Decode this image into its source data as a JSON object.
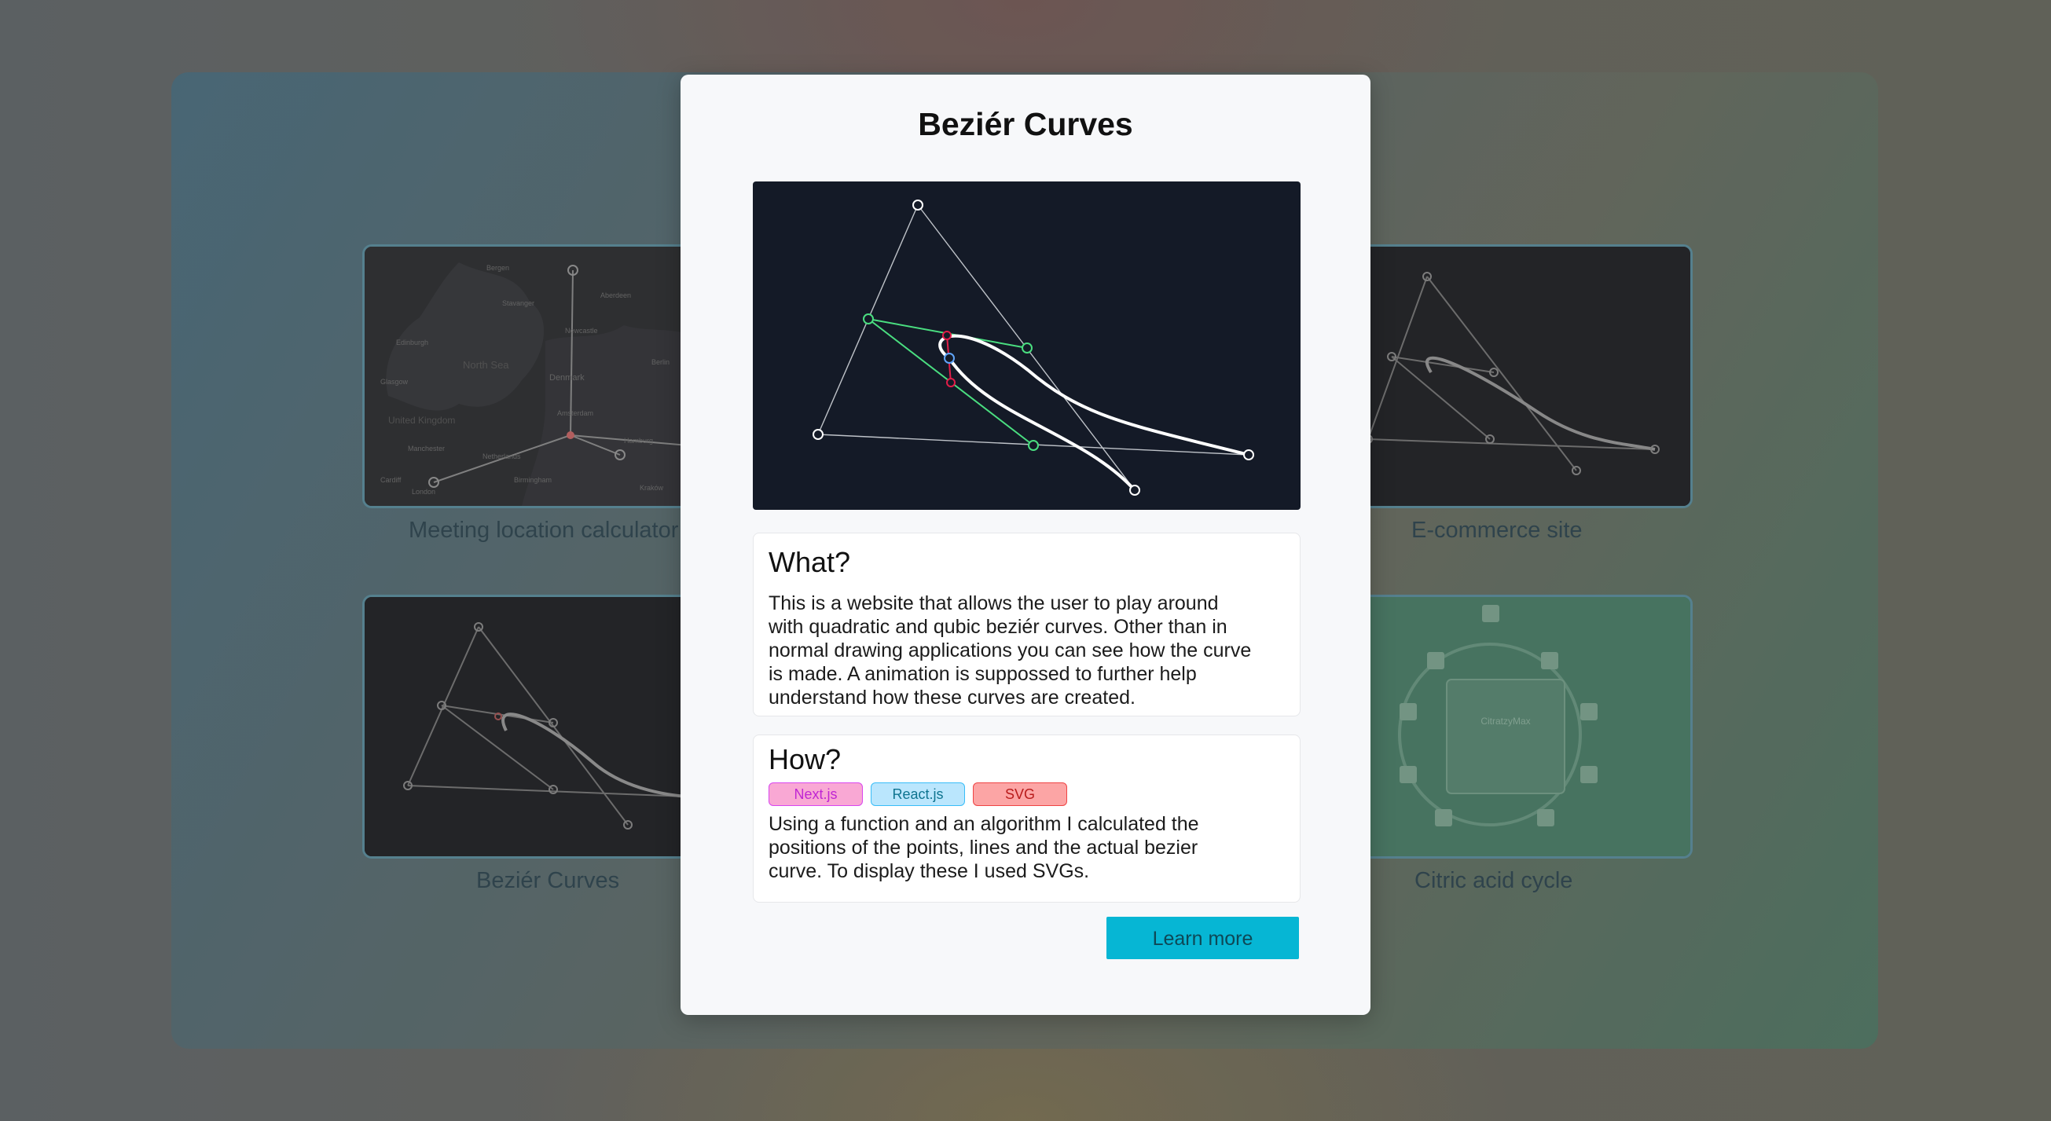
{
  "projects": [
    {
      "caption": "Meeting location calculator"
    },
    {
      "caption": "E-commerce site"
    },
    {
      "caption": "Beziér Curves"
    },
    {
      "caption": "Citric acid cycle"
    }
  ],
  "map_labels": [
    "Bergen",
    "Stavanger",
    "Aberdeen",
    "Edinburgh",
    "North Sea",
    "Denmark",
    "United Kingdom",
    "Glasgow",
    "Newcastle",
    "Manchester",
    "London",
    "Amsterdam",
    "Hamburg",
    "Berlin",
    "Cardiff",
    "Birmingham",
    "Netherlands",
    "Kraków"
  ],
  "citric_card": {
    "title": "CitratzyMax"
  },
  "modal": {
    "title": "Beziér Curves",
    "what": {
      "heading": "What?",
      "lines": [
        "This is a website that allows the user to play around",
        "with quadratic and qubic beziér curves. Other than in",
        "normal drawing applications you can see how the curve",
        "is made. A animation is suppossed to further help",
        "understand how these curves are created."
      ]
    },
    "how": {
      "heading": "How?",
      "tags": [
        {
          "label": "Next.js",
          "bg": "#f9a8d4",
          "border": "#d946ef",
          "color": "#c026d3"
        },
        {
          "label": "React.js",
          "bg": "#bae6fd",
          "border": "#38bdf8",
          "color": "#0e7490"
        },
        {
          "label": "SVG",
          "bg": "#fca5a5",
          "border": "#ef4444",
          "color": "#b91c1c"
        }
      ],
      "lines": [
        "Using a function and an algorithm I calculated the",
        "positions of the points, lines and the actual bezier",
        "curve. To display these I used SVGs."
      ]
    },
    "learn_more": "Learn more"
  },
  "colors": {
    "accent": "#06b6d4",
    "preview_bg": "#141a27",
    "construction_green": "#4ade80",
    "construction_red": "#e11d48"
  }
}
